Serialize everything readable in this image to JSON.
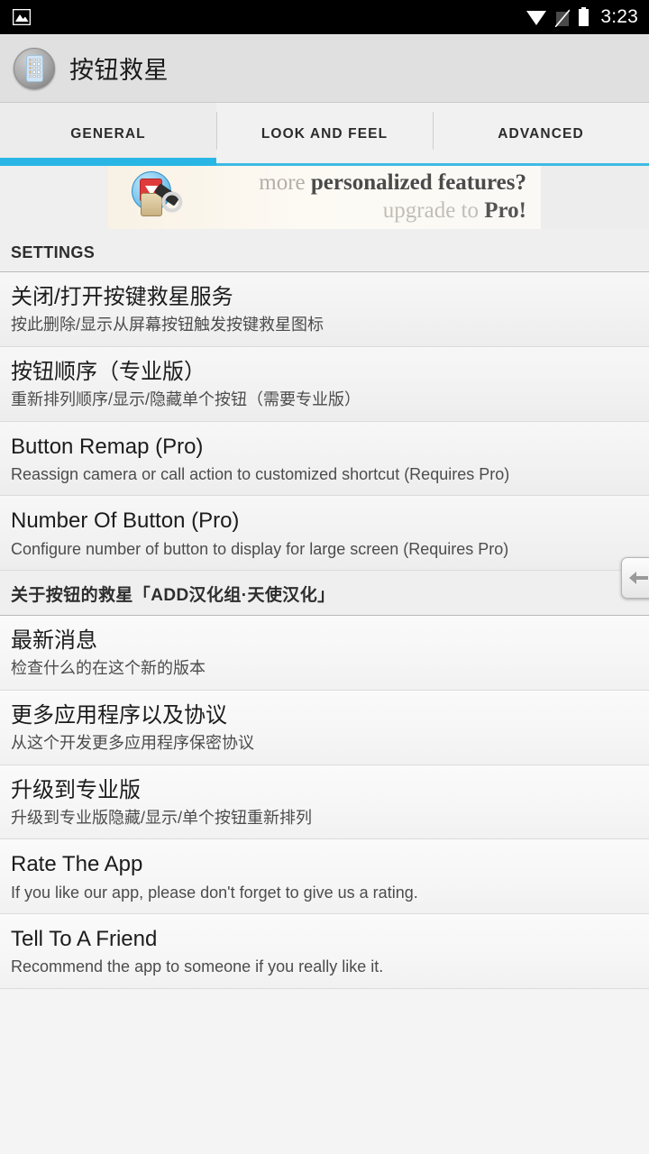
{
  "statusbar": {
    "time": "3:23",
    "icons": {
      "left": [
        "image-icon"
      ],
      "right": [
        "wifi-icon",
        "no-sim-icon",
        "battery-icon"
      ]
    }
  },
  "actionbar": {
    "app_icon": "app-keypad-icon",
    "title": "按钮救星"
  },
  "tabs": [
    {
      "label": "GENERAL",
      "active": true
    },
    {
      "label": "LOOK AND FEEL",
      "active": false
    },
    {
      "label": "ADVANCED",
      "active": false
    }
  ],
  "banner": {
    "icon": "lock-key-upgrade-icon",
    "line1_plain": "more ",
    "line1_bold": "personalized features?",
    "line2_plain": "upgrade to ",
    "line2_bold": "Pro!"
  },
  "sections": [
    {
      "header": "SETTINGS",
      "header_style": "latin",
      "items": [
        {
          "title": "关闭/打开按键救星服务",
          "subtitle": "按此删除/显示从屏幕按钮触发按键救星图标"
        },
        {
          "title": "按钮顺序（专业版）",
          "subtitle": "重新排列顺序/显示/隐藏单个按钮（需要专业版）"
        },
        {
          "title": "Button Remap (Pro)",
          "subtitle": "Reassign camera or call action to customized shortcut (Requires Pro)"
        },
        {
          "title": "Number Of Button (Pro)",
          "subtitle": "Configure number of button to display for large screen (Requires Pro)"
        }
      ]
    },
    {
      "header": "关于按钮的救星「ADD汉化组·天使汉化」",
      "header_style": "cjk",
      "items": [
        {
          "title": "最新消息",
          "subtitle": "检查什么的在这个新的版本"
        },
        {
          "title": "更多应用程序以及协议",
          "subtitle": "从这个开发更多应用程序保密协议"
        },
        {
          "title": "升级到专业版",
          "subtitle": "升级到专业版隐藏/显示/单个按钮重新排列"
        },
        {
          "title": "Rate The App",
          "subtitle": "If you like our app, please don't forget to give us a rating."
        },
        {
          "title": "Tell To A Friend",
          "subtitle": "Recommend the app to someone if you really like it."
        }
      ]
    }
  ],
  "overlay": {
    "icon": "back-arrow-icon"
  },
  "colors": {
    "accent": "#29b6e5",
    "statusbar_bg": "#000000",
    "actionbar_bg": "#e0e0e0",
    "content_bg": "#f4f4f4"
  }
}
